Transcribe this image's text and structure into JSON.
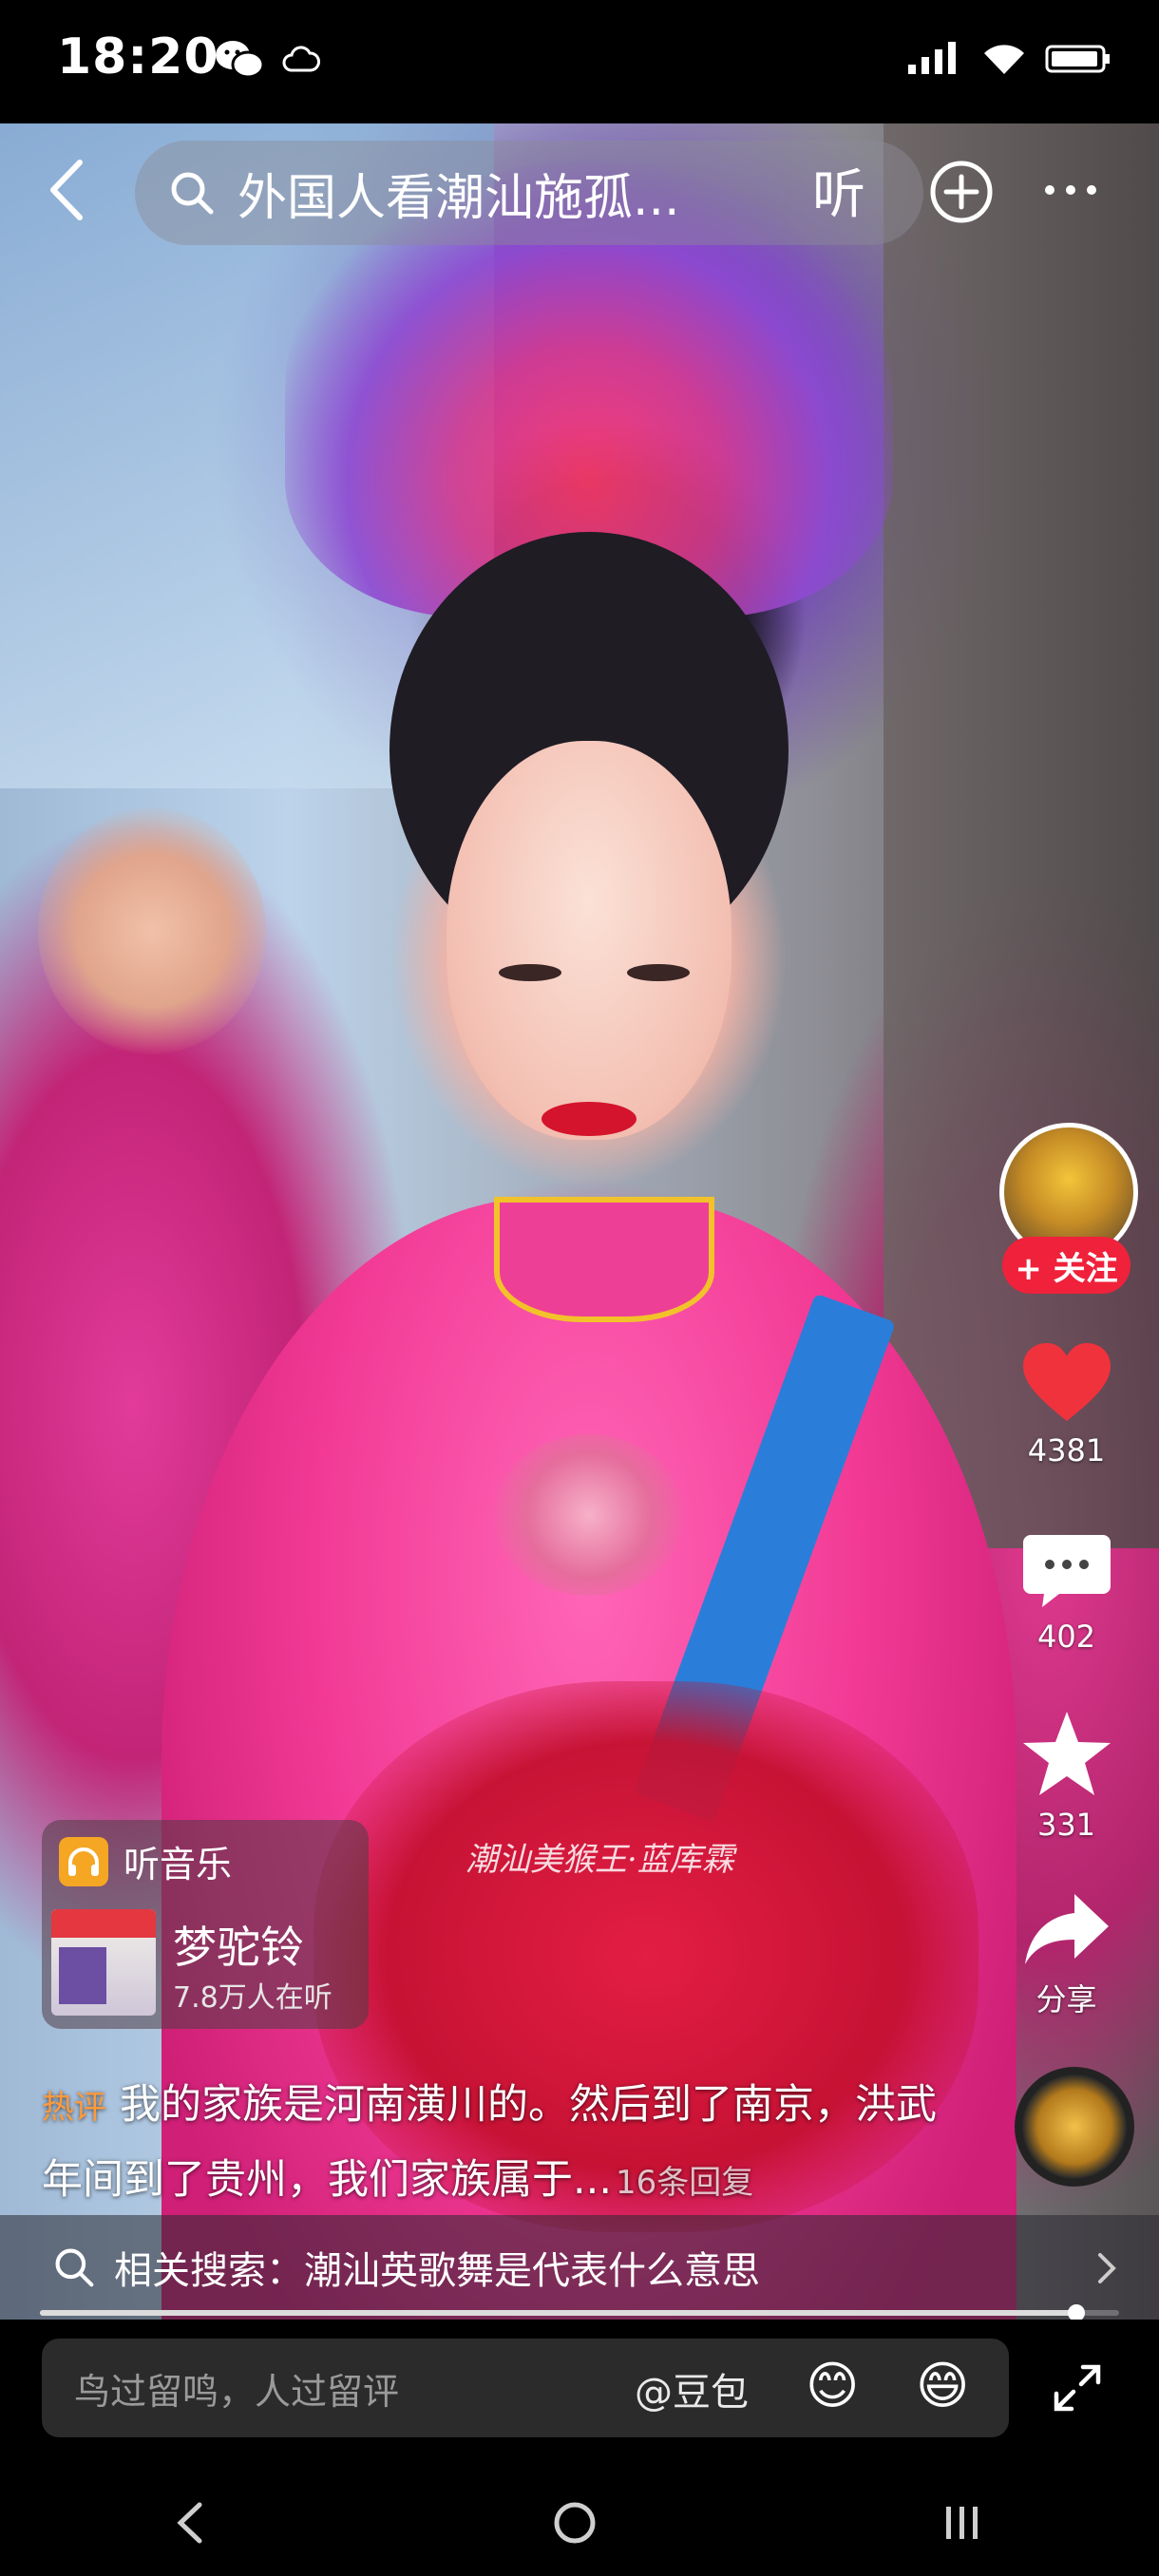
{
  "status_bar": {
    "time": "18:20"
  },
  "header": {
    "search_query": "外国人看潮汕施孤...",
    "listen_label": "听"
  },
  "actions": {
    "follow_label": "+ 关注",
    "likes": "4381",
    "comments": "402",
    "favorites": "331",
    "share_label": "分享"
  },
  "music": {
    "header_label": "听音乐",
    "title": "梦驼铃",
    "listeners": "7.8万人在听"
  },
  "video": {
    "watermark": "潮汕美猴王·蓝库霖"
  },
  "hot_comment": {
    "tag": "热评",
    "text": "我的家族是河南潢川的。然后到了南京，洪武年间到了贵州，我们家族属于...",
    "reply_count": "16条回复"
  },
  "related_search": {
    "text": "相关搜索：潮汕英歌舞是代表什么意思"
  },
  "progress": {
    "fraction": 0.96
  },
  "comment_bar": {
    "placeholder": "鸟过留鸣，人过留评",
    "mention": "@豆包",
    "emoji_1": "😊",
    "emoji_2": "😄"
  },
  "colors": {
    "accent_red": "#f0213b",
    "hot_tag": "#ff9a3c"
  }
}
